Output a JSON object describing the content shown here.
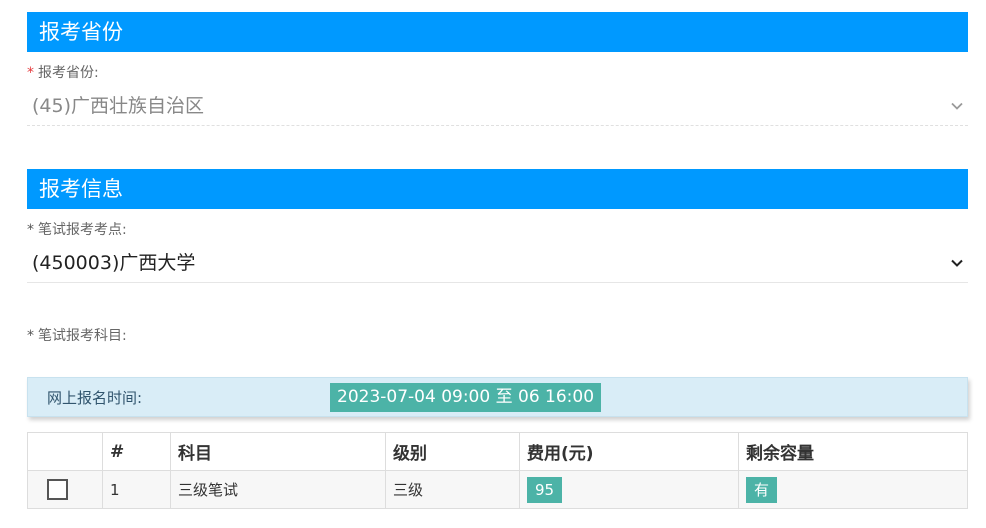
{
  "sections": {
    "province": {
      "title": "报考省份",
      "label": "报考省份:",
      "value": "(45)广西壮族自治区"
    },
    "info": {
      "title": "报考信息",
      "site_label": "笔试报考考点:",
      "site_value": "(450003)广西大学",
      "subject_label": "笔试报考科目:"
    }
  },
  "required_mark": "*",
  "registration": {
    "label": "网上报名时间:",
    "value": "2023-07-04 09:00 至 06 16:00"
  },
  "table": {
    "headers": [
      "",
      "#",
      "科目",
      "级别",
      "费用(元)",
      "剩余容量"
    ],
    "rows": [
      {
        "index": "1",
        "subject": "三级笔试",
        "level": "三级",
        "fee": "95",
        "capacity": "有"
      }
    ]
  },
  "colors": {
    "header_blue": "#0099ff",
    "tag_teal": "#4cb3a7",
    "info_bg": "#d9edf7",
    "required_red": "#e4393c"
  }
}
